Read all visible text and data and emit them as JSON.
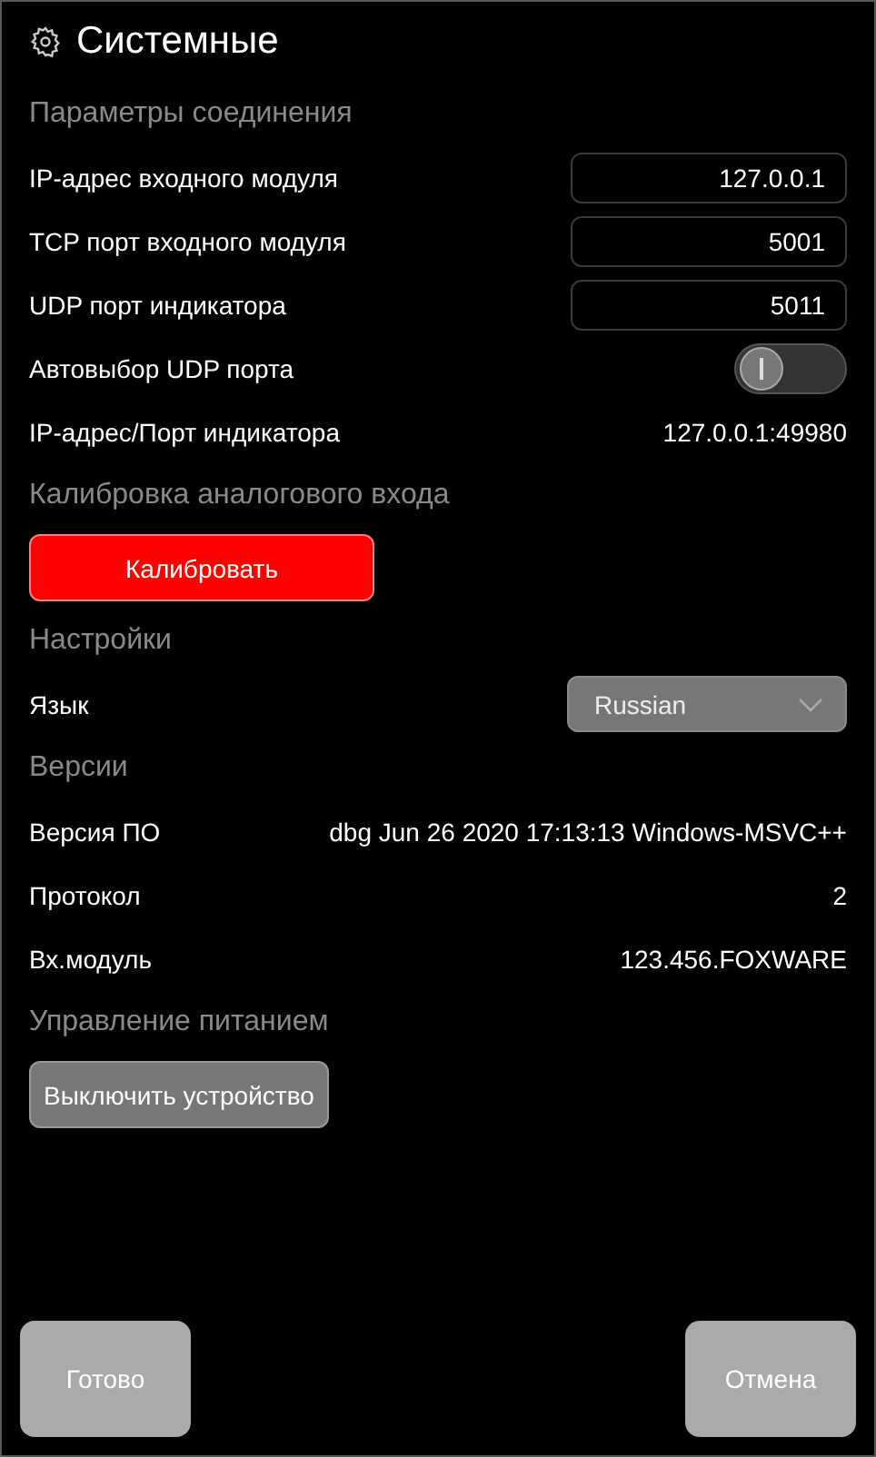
{
  "title": "Системные",
  "sections": [
    {
      "heading": "Параметры соединения",
      "items": [
        {
          "kind": "field",
          "label": "IP-адрес входного модуля",
          "value": "127.0.0.1"
        },
        {
          "kind": "field",
          "label": "TCP порт входного модуля",
          "value": "5001"
        },
        {
          "kind": "field",
          "label": "UDP порт индикатора",
          "value": "5011"
        },
        {
          "kind": "toggle",
          "label": "Автовыбор UDP порта",
          "on": false
        },
        {
          "kind": "text",
          "label": "IP-адрес/Порт индикатора",
          "value": "127.0.0.1:49980"
        }
      ]
    },
    {
      "heading": "Калибровка аналогового входа",
      "items": [
        {
          "kind": "danger-button",
          "label": "Калибровать"
        }
      ]
    },
    {
      "heading": "Настройки",
      "items": [
        {
          "kind": "select",
          "label": "Язык",
          "value": "Russian"
        }
      ]
    },
    {
      "heading": "Версии",
      "items": [
        {
          "kind": "text",
          "label": "Версия ПО",
          "value": "dbg Jun 26 2020 17:13:13 Windows-MSVC++"
        },
        {
          "kind": "text",
          "label": "Протокол",
          "value": "2"
        },
        {
          "kind": "text",
          "label": "Вх.модуль",
          "value": "123.456.FOXWARE"
        }
      ]
    },
    {
      "heading": "Управление питанием",
      "items": [
        {
          "kind": "button",
          "label": "Выключить устройство"
        }
      ]
    }
  ],
  "buttons": [
    "Готово",
    "Отмена"
  ]
}
